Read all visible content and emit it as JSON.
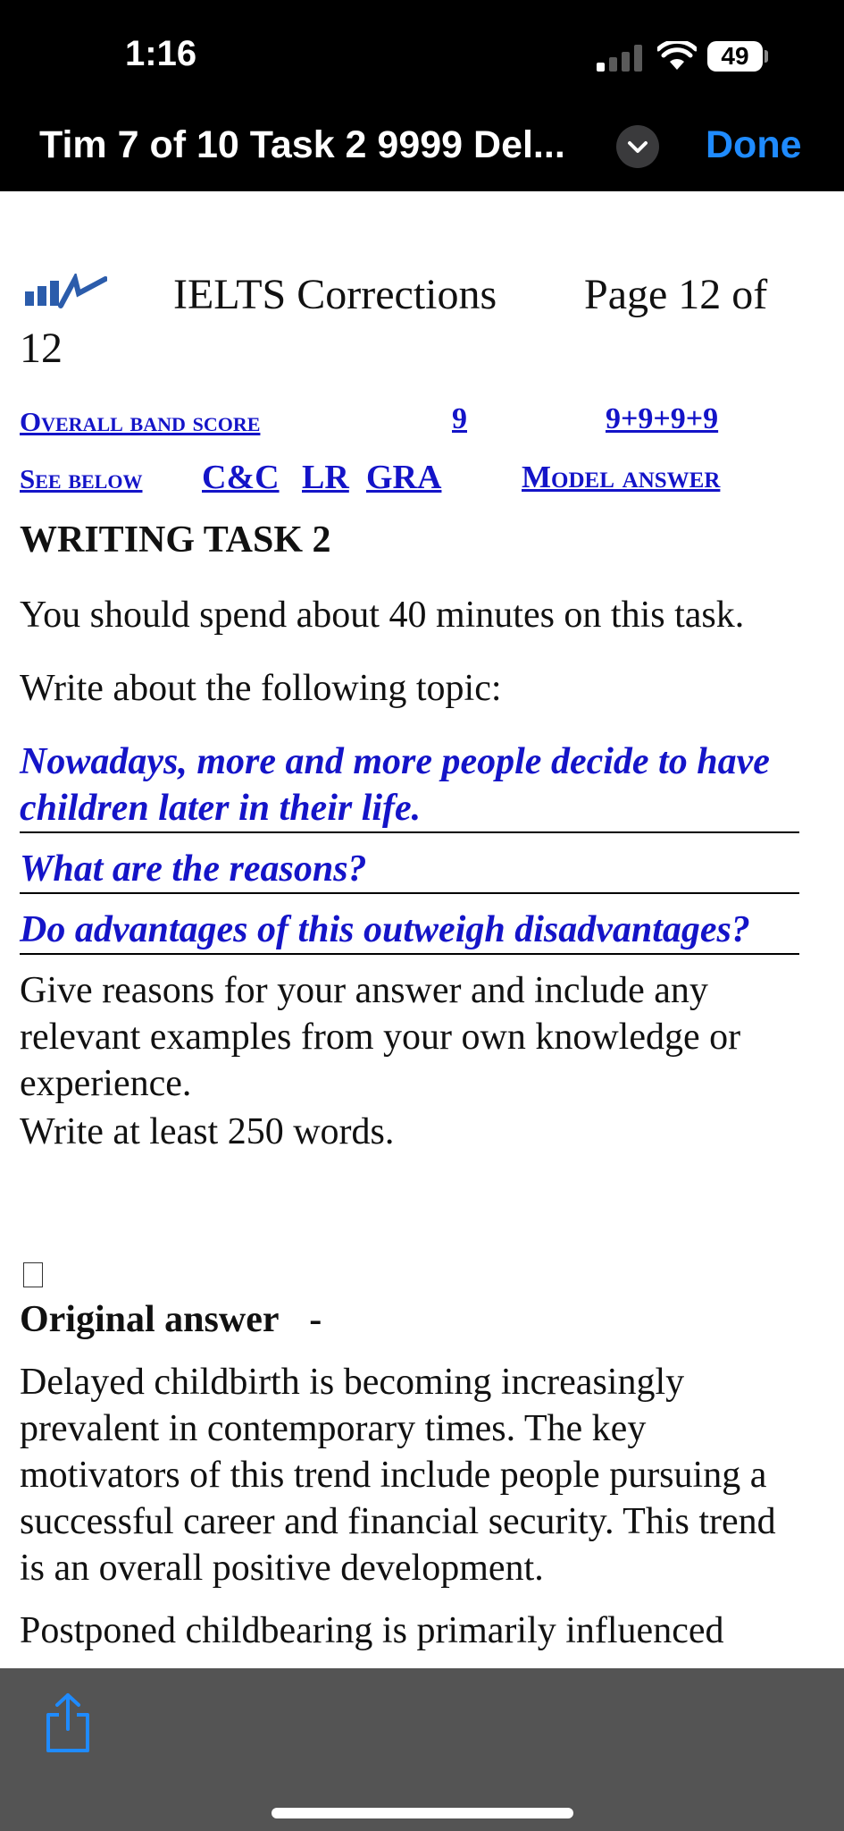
{
  "status_bar": {
    "time": "1:16",
    "battery": "49"
  },
  "title_bar": {
    "title": "Tim 7 of 10 Task 2 9999 Del...",
    "done_label": "Done"
  },
  "doc_header": {
    "title": "IELTS Corrections",
    "page": "Page 12 of",
    "page_total": "12"
  },
  "score_links": {
    "overall_label": "Overall band score",
    "overall_value": "9",
    "breakdown": "9+9+9+9",
    "see_below": "See below",
    "cc": "C&C",
    "lr": "LR",
    "gra": "GRA",
    "model_answer": "Model answer"
  },
  "task": {
    "heading": "WRITING TASK 2",
    "instruction": "You should spend about 40 minutes on this task.",
    "write_about": "Write about the following topic:",
    "topic_1": "Nowadays, more and more people decide to have children later in their life.",
    "topic_2": "What are the reasons?",
    "topic_3": "Do advantages of this outweigh disadvantages?",
    "give_reasons": "Give reasons for your answer and include any relevant examples from your own knowledge or experience.",
    "word_count": "Write at least 250 words."
  },
  "answer": {
    "heading": "Original answer",
    "dash": "-",
    "paragraph_1": "Delayed childbirth is becoming increasingly prevalent in contemporary times. The key motivators of this trend include people pursuing a successful career and financial security. This trend is an overall positive development.",
    "paragraph_2_start": "Postponed childbearing is primarily influenced"
  },
  "icons": {
    "logo": "chart-logo-icon",
    "chevron": "chevron-down-icon",
    "share": "share-icon"
  },
  "colors": {
    "link": "#1414c8",
    "accent": "#1f8bff",
    "toolbar": "#545454"
  }
}
